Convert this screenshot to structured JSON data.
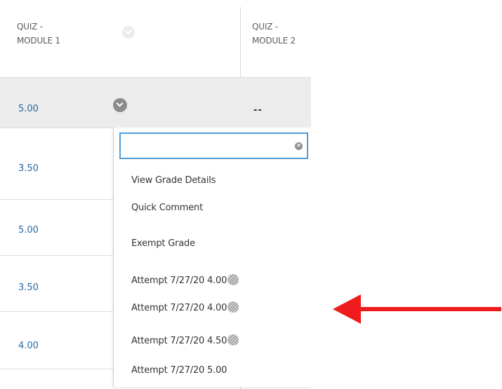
{
  "columns": [
    {
      "header": "QUIZ -\nMODULE 1"
    },
    {
      "header": "QUIZ -\nMODULE 2"
    }
  ],
  "rows": [
    {
      "grade": "5.00",
      "module2": "--"
    },
    {
      "grade": "3.50"
    },
    {
      "grade": "5.00"
    },
    {
      "grade": "3.50"
    },
    {
      "grade": "4.00"
    }
  ],
  "menu": {
    "search_value": "",
    "items": [
      {
        "label": "View Grade Details"
      },
      {
        "label": "Quick Comment"
      },
      {
        "label": "Exempt Grade"
      },
      {
        "label": "Attempt 7/27/20 4.00",
        "icon": "attempt-status-icon"
      },
      {
        "label": "Attempt 7/27/20 4.00",
        "icon": "attempt-status-icon"
      },
      {
        "label": "Attempt 7/27/20 4.50",
        "icon": "attempt-status-icon"
      },
      {
        "label": "Attempt 7/27/20 5.00"
      }
    ],
    "clear_icon": "clear-icon"
  },
  "annotation": {
    "icon": "arrow-left-icon",
    "color": "#ee1c1c"
  },
  "colors": {
    "grade_link": "#2a6aa4",
    "selected_row": "#ececec",
    "search_focus": "#4f9bd9"
  }
}
